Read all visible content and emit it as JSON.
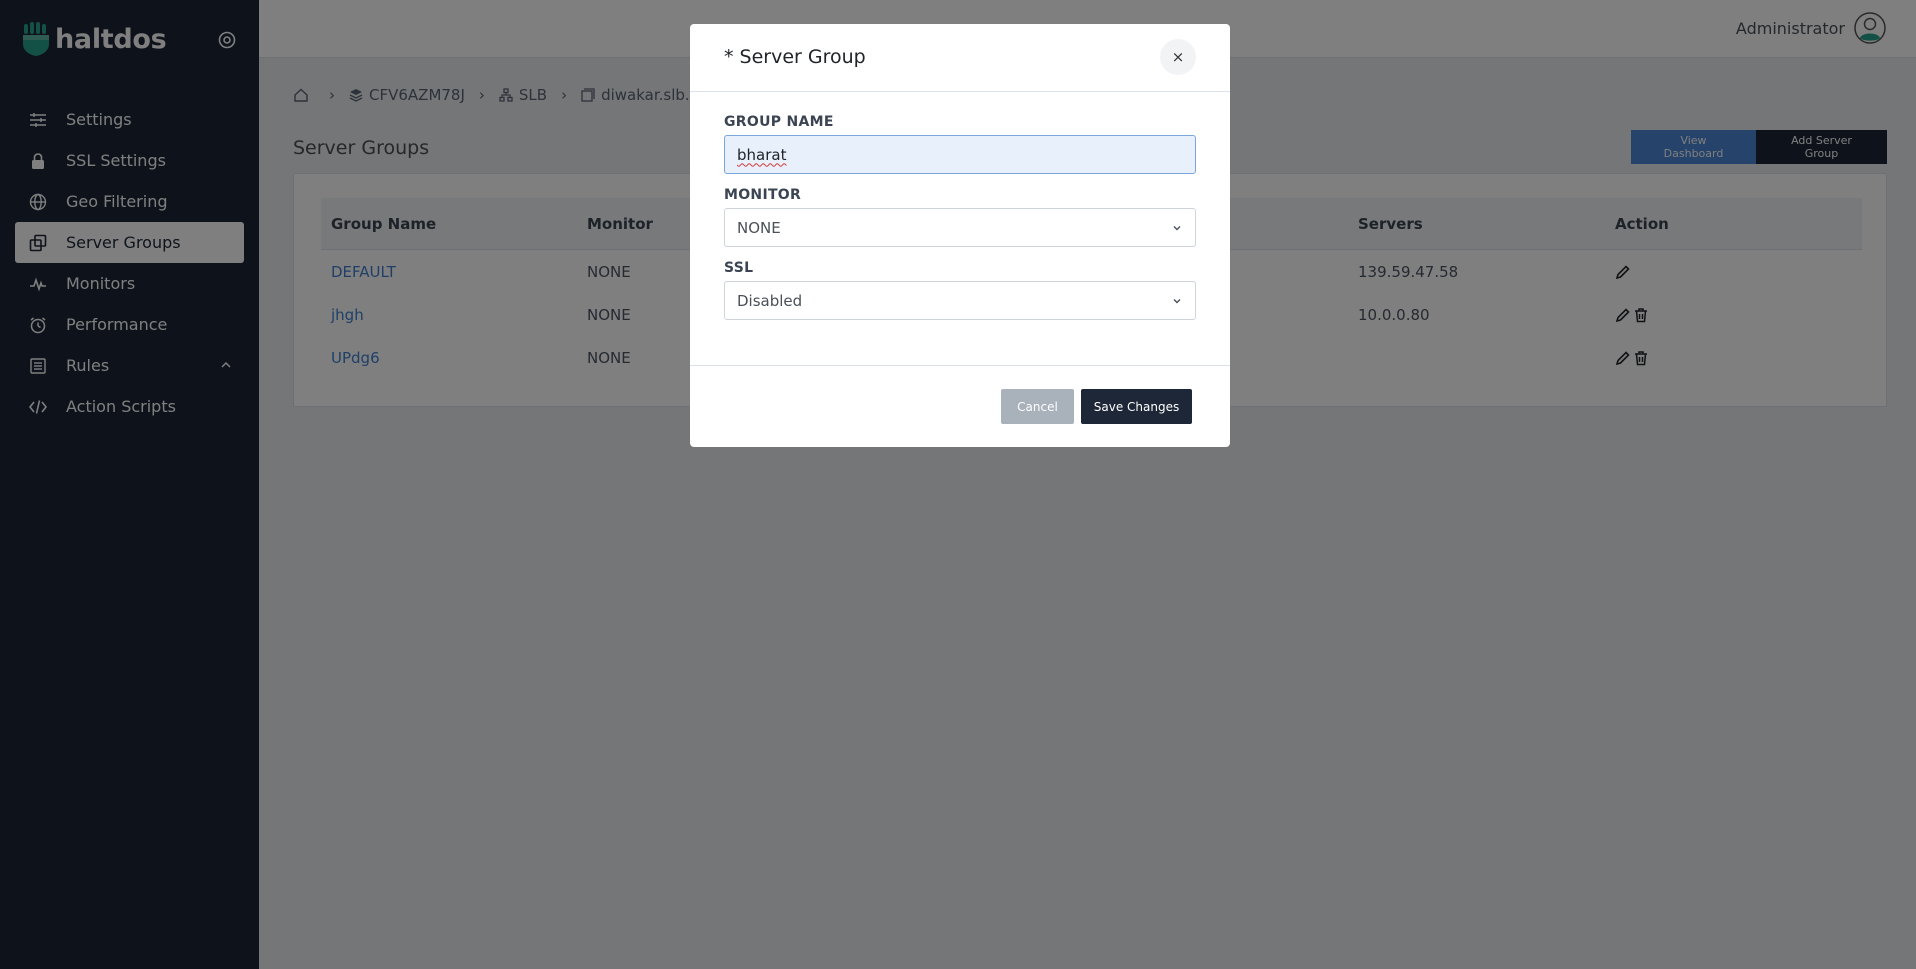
{
  "brand": {
    "name": "haltdos"
  },
  "sidebar": {
    "items": [
      {
        "label": "Settings",
        "icon": "sliders-icon"
      },
      {
        "label": "SSL Settings",
        "icon": "lock-icon"
      },
      {
        "label": "Geo Filtering",
        "icon": "globe-icon"
      },
      {
        "label": "Server Groups",
        "icon": "server-groups-icon",
        "active": true
      },
      {
        "label": "Monitors",
        "icon": "pulse-icon"
      },
      {
        "label": "Performance",
        "icon": "timer-icon"
      },
      {
        "label": "Rules",
        "icon": "list-icon",
        "expandable": true
      },
      {
        "label": "Action Scripts",
        "icon": "code-icon"
      }
    ]
  },
  "header": {
    "user_name": "Administrator"
  },
  "breadcrumb": {
    "items": [
      "CFV6AZM78J",
      "SLB",
      "diwakar.slb.co"
    ]
  },
  "main": {
    "title": "Server Groups",
    "view_dashboard_label": "View Dashboard",
    "add_server_group_label": "Add Server Group",
    "table": {
      "columns": [
        "Group Name",
        "Monitor",
        "Servers",
        "Action"
      ],
      "rows": [
        {
          "group_name": "DEFAULT",
          "monitor": "NONE",
          "servers": "139.59.47.58",
          "deletable": false
        },
        {
          "group_name": "jhgh",
          "monitor": "NONE",
          "servers": "10.0.0.80",
          "deletable": true
        },
        {
          "group_name": "UPdg6",
          "monitor": "NONE",
          "servers": "",
          "deletable": true
        }
      ]
    }
  },
  "modal": {
    "title": "* Server Group",
    "close_label": "×",
    "group_name_label": "GROUP NAME",
    "group_name_value": "bharat",
    "monitor_label": "MONITOR",
    "monitor_value": "NONE",
    "ssl_label": "SSL",
    "ssl_value": "Disabled",
    "cancel_label": "Cancel",
    "save_label": "Save Changes"
  },
  "colors": {
    "sidebar_bg": "#1d2737",
    "brand_accent": "#27a08a",
    "link": "#3f7fcf",
    "primary_dark": "#1d2737",
    "view_dashboard_bg": "#4a86d6"
  }
}
